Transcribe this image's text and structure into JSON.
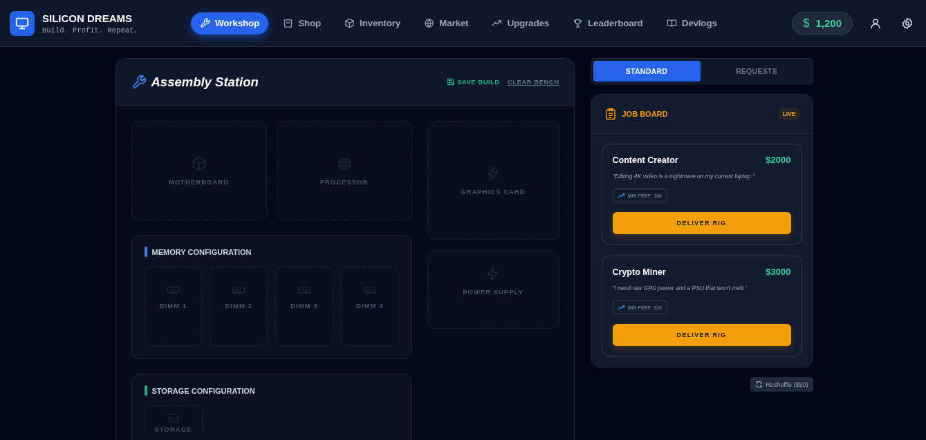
{
  "brand": {
    "title": "SILICON DREAMS",
    "tagline": "Build. Profit. Repeat."
  },
  "nav": [
    {
      "label": "Workshop",
      "selected": true
    },
    {
      "label": "Shop",
      "selected": false
    },
    {
      "label": "Inventory",
      "selected": false
    },
    {
      "label": "Market",
      "selected": false
    },
    {
      "label": "Upgrades",
      "selected": false
    },
    {
      "label": "Leaderboard",
      "selected": false
    },
    {
      "label": "Devlogs",
      "selected": false
    }
  ],
  "balance": {
    "symbol": "$",
    "amount": "1,200"
  },
  "assembly": {
    "title": "Assembly Station",
    "save": "SAVE BUILD",
    "clear": "CLEAR BENCH",
    "motherboard": "MOTHERBOARD",
    "processor": "PROCESSOR",
    "graphics": "GRAPHICS CARD",
    "power": "POWER SUPPLY",
    "memory": {
      "title": "MEMORY CONFIGURATION",
      "slots": [
        "DIMM 1",
        "DIMM 2",
        "DIMM 3",
        "DIMM 4"
      ]
    },
    "storage": {
      "title": "STORAGE CONFIGURATION",
      "slots": [
        "STORAGE"
      ]
    }
  },
  "mode_tabs": [
    {
      "label": "STANDARD",
      "selected": true
    },
    {
      "label": "REQUESTS",
      "selected": false
    }
  ],
  "job_board": {
    "title": "JOB BOARD",
    "badge": "LIVE",
    "jobs": [
      {
        "title": "Content Creator",
        "reward": "$2000",
        "quote": "\"Editing 4K video is a nightmare on my current laptop.\"",
        "requirement": "MIN PERF: 160",
        "button": "DELIVER RIG"
      },
      {
        "title": "Crypto Miner",
        "reward": "$3000",
        "quote": "\"I need raw GPU power and a PSU that won't melt.\"",
        "requirement": "MIN PERF: 220",
        "button": "DELIVER RIG"
      }
    ]
  },
  "reshuffle": "Reshuffle ($50)"
}
